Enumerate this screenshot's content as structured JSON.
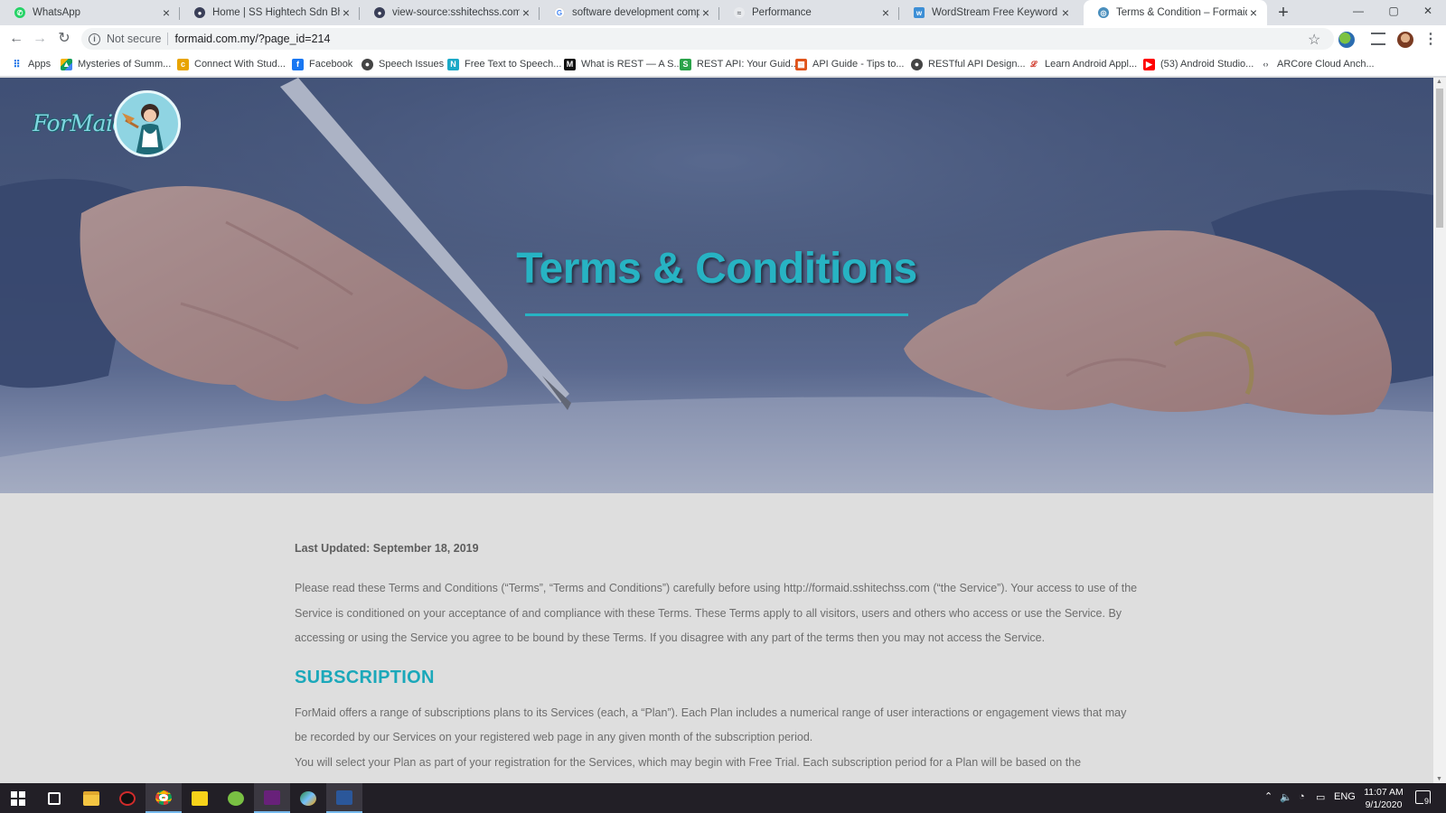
{
  "tabs": [
    {
      "title": "WhatsApp",
      "icon": "whatsapp-icon",
      "color": "#25d366"
    },
    {
      "title": "Home | SS Hightech Sdn Bhd",
      "icon": "site-icon",
      "color": "#3a3f58"
    },
    {
      "title": "view-source:sshitechss.com/inde",
      "icon": "site-icon",
      "color": "#3a3f58"
    },
    {
      "title": "software development company",
      "icon": "google-icon",
      "color": "#4285f4"
    },
    {
      "title": "Performance",
      "icon": "performance-icon",
      "color": "#5f6368"
    },
    {
      "title": "WordStream Free Keyword Tool",
      "icon": "wordstream-icon",
      "color": "#3d8fd6"
    },
    {
      "title": "Terms & Condition – Formaid",
      "icon": "globe-icon",
      "color": "#4a8fbd"
    }
  ],
  "address_bar": {
    "security": "Not secure",
    "url": "formaid.com.my/?page_id=214"
  },
  "bookmarks": [
    {
      "label": "Apps",
      "icon": "apps-grid-icon",
      "color": "#1a73e8"
    },
    {
      "label": "Mysteries of Summ...",
      "icon": "drive-icon",
      "color": "#f4b400"
    },
    {
      "label": "Connect With Stud...",
      "icon": "c-icon",
      "color": "#e8a400"
    },
    {
      "label": "Facebook",
      "icon": "facebook-icon",
      "color": "#1877f2"
    },
    {
      "label": "Speech Issues",
      "icon": "globe-icon",
      "color": "#444444"
    },
    {
      "label": "Free Text to Speech...",
      "icon": "n-icon",
      "color": "#1aa9c7"
    },
    {
      "label": "What is REST — A S...",
      "icon": "medium-icon",
      "color": "#111111"
    },
    {
      "label": "REST API: Your Guid...",
      "icon": "rest-icon",
      "color": "#2aa34a"
    },
    {
      "label": "API Guide - Tips to...",
      "icon": "api-icon",
      "color": "#e0531a"
    },
    {
      "label": "RESTful API Design...",
      "icon": "globe-icon",
      "color": "#444444"
    },
    {
      "label": "Learn Android Appl...",
      "icon": "android-learn-icon",
      "color": "#d23f31"
    },
    {
      "label": "(53) Android Studio...",
      "icon": "youtube-icon",
      "color": "#ff0000"
    },
    {
      "label": "ARCore Cloud Anch...",
      "icon": "code-icon",
      "color": "#5f6368"
    }
  ],
  "site": {
    "logo_text": "ForMaid",
    "hero_title": "Terms & Conditions",
    "accent_color": "#27b3c3"
  },
  "content": {
    "last_updated": "Last Updated: September 18, 2019",
    "intro": "Please read these Terms and Conditions (“Terms”, “Terms and Conditions”) carefully before using http://formaid.sshitechss.com (“the Service”). Your access to use of the Service is conditioned on your acceptance of and compliance with these Terms. These Terms apply to all visitors, users and others who access or use the Service. By accessing or using the Service you agree to be bound by these Terms. If you disagree with any part of the terms then you may not access the Service.",
    "subscription_heading": "SUBSCRIPTION",
    "subscription_p1": "ForMaid offers a range of subscriptions plans to its Services (each, a “Plan”). Each Plan includes a numerical range of user interactions or engagement views that may be recorded by our Services on your registered web page in any given month of the subscription period.",
    "subscription_p2": "You will select your Plan as part of your registration for the Services, which may begin with Free Trial. Each subscription period for a Plan will be based on the"
  },
  "taskbar": {
    "language": "ENG",
    "time": "11:07 AM",
    "date": "9/1/2020",
    "notification_count": "9",
    "apps": [
      "windows-start-icon",
      "task-view-icon",
      "file-explorer-icon",
      "app-red-icon",
      "chrome-icon",
      "sticky-notes-icon",
      "android-studio-icon",
      "visual-studio-icon",
      "photos-icon",
      "word-icon"
    ]
  }
}
